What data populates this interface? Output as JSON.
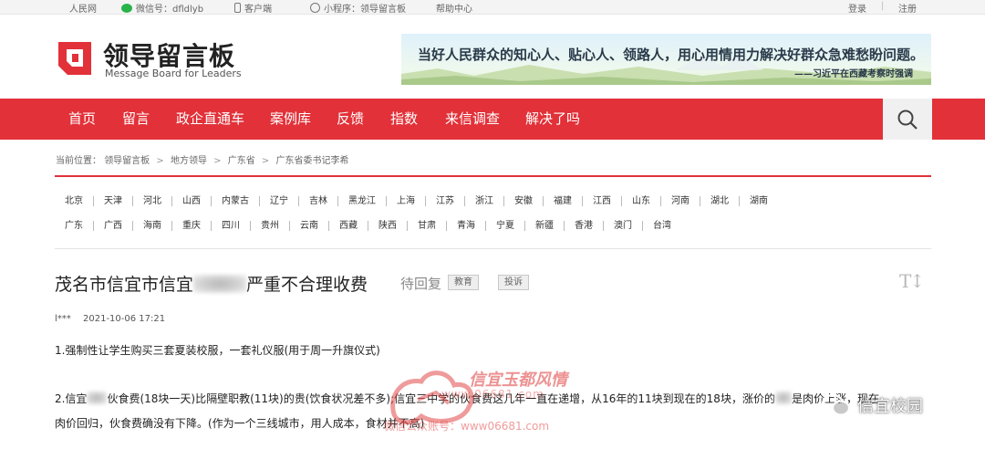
{
  "topbar": {
    "people": "人民网",
    "wechat": "微信号：dfldlyb",
    "client": "客户端",
    "miniprogram": "小程序：领导留言板",
    "help": "帮助中心",
    "login": "登录",
    "divider": "|",
    "register": "注册"
  },
  "brand": {
    "name_cn": "领导留言板",
    "name_en": "Message Board for Leaders",
    "color": "#e23139"
  },
  "banner": {
    "quote": "当好人民群众的知心人、贴心人、领路人，用心用情用力解决好群众急难愁盼问题。",
    "source": "——习近平在西藏考察时强调"
  },
  "nav": {
    "items": [
      "首页",
      "留言",
      "政企直通车",
      "案例库",
      "反馈",
      "指数",
      "来信调查",
      "解决了吗"
    ],
    "search_icon": "search-icon",
    "background": "#e23139"
  },
  "breadcrumb": {
    "prefix": "当前位置：",
    "items": [
      "领导留言板",
      "地方领导",
      "广东省",
      "广东省委书记李希"
    ],
    "separator": ">"
  },
  "provinces": {
    "row1": [
      "北京",
      "天津",
      "河北",
      "山西",
      "内蒙古",
      "辽宁",
      "吉林",
      "黑龙江",
      "上海",
      "江苏",
      "浙江",
      "安徽",
      "福建",
      "江西",
      "山东",
      "河南",
      "湖北",
      "湖南"
    ],
    "row2": [
      "广东",
      "广西",
      "海南",
      "重庆",
      "四川",
      "贵州",
      "云南",
      "西藏",
      "陕西",
      "甘肃",
      "青海",
      "宁夏",
      "新疆",
      "香港",
      "澳门",
      "台湾"
    ]
  },
  "article": {
    "title_start": "茂名市信宜市信宜",
    "title_end": "严重不合理收费",
    "status": "待回复",
    "tag_category": "教育",
    "tag_complaint": "投诉",
    "font_toggle": "T↕",
    "user": "l***",
    "time": "2021-10-06 17:21",
    "para1": "1.强制性让学生购买三套夏装校服，一套礼仪服(用于周一升旗仪式)",
    "para2_a": "2.信宜",
    "para2_b": "伙食费(18块一天)比隔壁职教(11块)的贵(饮食状况差不多);信宜三中学的伙食费这几年一直在递增，从16年的11块到现在的18块，涨价的",
    "para2_c": "是肉价上涨，现在",
    "para3": "肉价回归，伙食费确没有下降。(作为一个三线城市，用人成本，食材并不高)"
  },
  "watermark": {
    "title": "信宜玉都风情",
    "url": "www.06681.com",
    "account": "微信公众账号：www06681.com",
    "corner": "信宜校园"
  }
}
